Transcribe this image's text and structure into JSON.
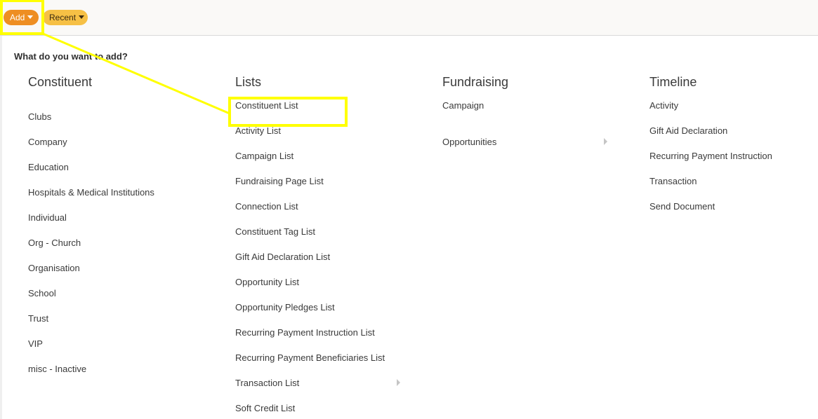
{
  "toolbar": {
    "add_label": "Add",
    "recent_label": "Recent"
  },
  "panel": {
    "prompt": "What do you want to add?"
  },
  "columns": {
    "constituent": {
      "title": "Constituent",
      "items": [
        "Clubs",
        "Company",
        "Education",
        "Hospitals & Medical Institutions",
        "Individual",
        "Org - Church",
        "Organisation",
        "School",
        "Trust",
        "VIP",
        "misc - Inactive"
      ]
    },
    "lists": {
      "title": "Lists",
      "items": [
        "Constituent List",
        "Activity List",
        "Campaign List",
        "Fundraising Page List",
        "Connection List",
        "Constituent Tag List",
        "Gift Aid Declaration List",
        "Opportunity List",
        "Opportunity Pledges List",
        "Recurring Payment Instruction List",
        "Recurring Payment Beneficiaries List",
        "Transaction List",
        "Soft Credit List"
      ]
    },
    "fundraising": {
      "title": "Fundraising",
      "items": [
        "Campaign",
        "Opportunities"
      ]
    },
    "timeline": {
      "title": "Timeline",
      "items": [
        "Activity",
        "Gift Aid Declaration",
        "Recurring Payment Instruction",
        "Transaction",
        "Send Document"
      ]
    }
  },
  "colors": {
    "add_button": "#ee8e22",
    "recent_button": "#f6c045",
    "highlight": "#ffff00"
  },
  "icons": {
    "add_caret": "caret-down-icon",
    "recent_caret": "caret-down-icon",
    "submenu": "chevron-right-icon"
  }
}
